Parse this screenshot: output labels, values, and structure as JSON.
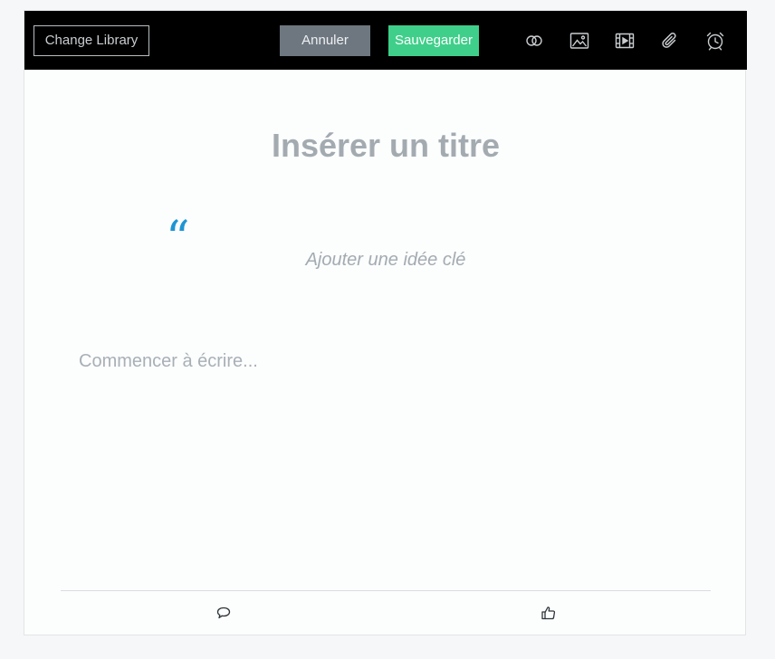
{
  "toolbar": {
    "change_library_label": "Change Library",
    "cancel_label": "Annuler",
    "save_label": "Sauvegarder",
    "icons": [
      "link-icon",
      "image-icon",
      "video-icon",
      "attachment-icon",
      "alarm-clock-icon"
    ],
    "background_color": "#000000",
    "cancel_color": "#6e7780",
    "save_color": "#3fcf8a"
  },
  "editor": {
    "title_placeholder": "Insérer un titre",
    "quote_mark": "“",
    "key_idea_placeholder": "Ajouter une idée clé",
    "body_placeholder": "Commencer à écrire...",
    "accent_color": "#1e95d3"
  },
  "footer": {
    "icons": [
      "comment-icon",
      "thumbs-up-icon"
    ]
  }
}
